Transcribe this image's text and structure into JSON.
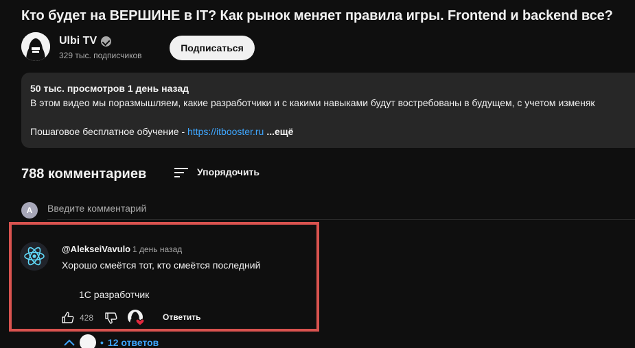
{
  "video": {
    "title": "Кто будет на ВЕРШИНЕ в IT? Как рынок меняет правила игры. Frontend и backend все?"
  },
  "channel": {
    "name": "Ulbi TV",
    "subscribers": "329 тыс. подписчиков",
    "subscribe_label": "Подписаться"
  },
  "description": {
    "stats": "50 тыс. просмотров  1 день назад",
    "line1": "В этом видео мы поразмышляем, какие разработчики и с какими навыками будут востребованы в будущем, с учетом изменяк",
    "line2_prefix": "Пошаговое бесплатное обучение - ",
    "link": "https://itbooster.ru",
    "more": "...ещё"
  },
  "comments": {
    "count": "788 комментариев",
    "sort_label": "Упорядочить",
    "my_avatar_letter": "A",
    "input_placeholder": "Введите комментарий"
  },
  "comment": {
    "author": "@AlekseiVavulo",
    "time": "1 день назад",
    "text_line1": "Хорошо смеётся тот, кто смеётся последний",
    "text_line2": "1С разработчик",
    "likes": "428",
    "reply_label": "Ответить",
    "replies_label": "12 ответов"
  },
  "colors": {
    "highlight_border": "#d9534f",
    "link": "#3ea6ff",
    "react_blue": "#61dafb"
  },
  "icons": [
    "verified-icon",
    "sort-icon",
    "like-icon",
    "dislike-icon",
    "creator-heart-icon",
    "chevron-up-icon",
    "react-logo-icon"
  ]
}
